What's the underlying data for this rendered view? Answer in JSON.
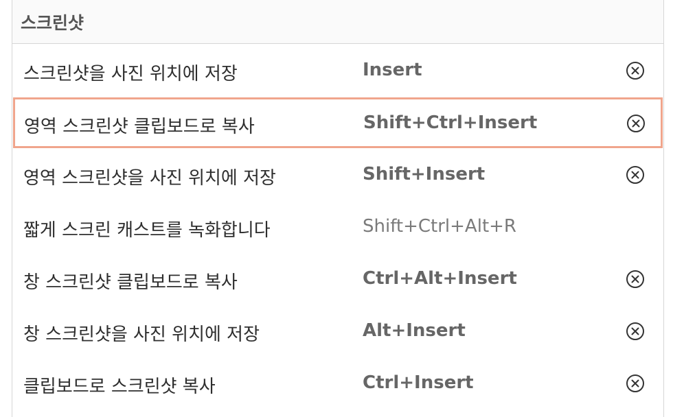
{
  "section": {
    "title": "스크린샷"
  },
  "rows": [
    {
      "label": "스크린샷을 사진 위치에 저장",
      "accel": "Insert",
      "custom": true
    },
    {
      "label": "영역 스크린샷 클립보드로 복사",
      "accel": "Shift+Ctrl+Insert",
      "custom": true,
      "selected": true
    },
    {
      "label": "영역 스크린샷을 사진 위치에 저장",
      "accel": "Shift+Insert",
      "custom": true
    },
    {
      "label": "짧게 스크린 캐스트를 녹화합니다",
      "accel": "Shift+Ctrl+Alt+R",
      "custom": false
    },
    {
      "label": "창 스크린샷 클립보드로 복사",
      "accel": "Ctrl+Alt+Insert",
      "custom": true
    },
    {
      "label": "창 스크린샷을 사진 위치에 저장",
      "accel": "Alt+Insert",
      "custom": true
    },
    {
      "label": "클립보드로 스크린샷 복사",
      "accel": "Ctrl+Insert",
      "custom": true
    }
  ],
  "icons": {
    "reset": "reset-icon"
  },
  "colors": {
    "selection_border": "#f0a58c",
    "header_text": "#555555",
    "accel_custom": "#666666",
    "accel_default": "#7a7a7a"
  }
}
